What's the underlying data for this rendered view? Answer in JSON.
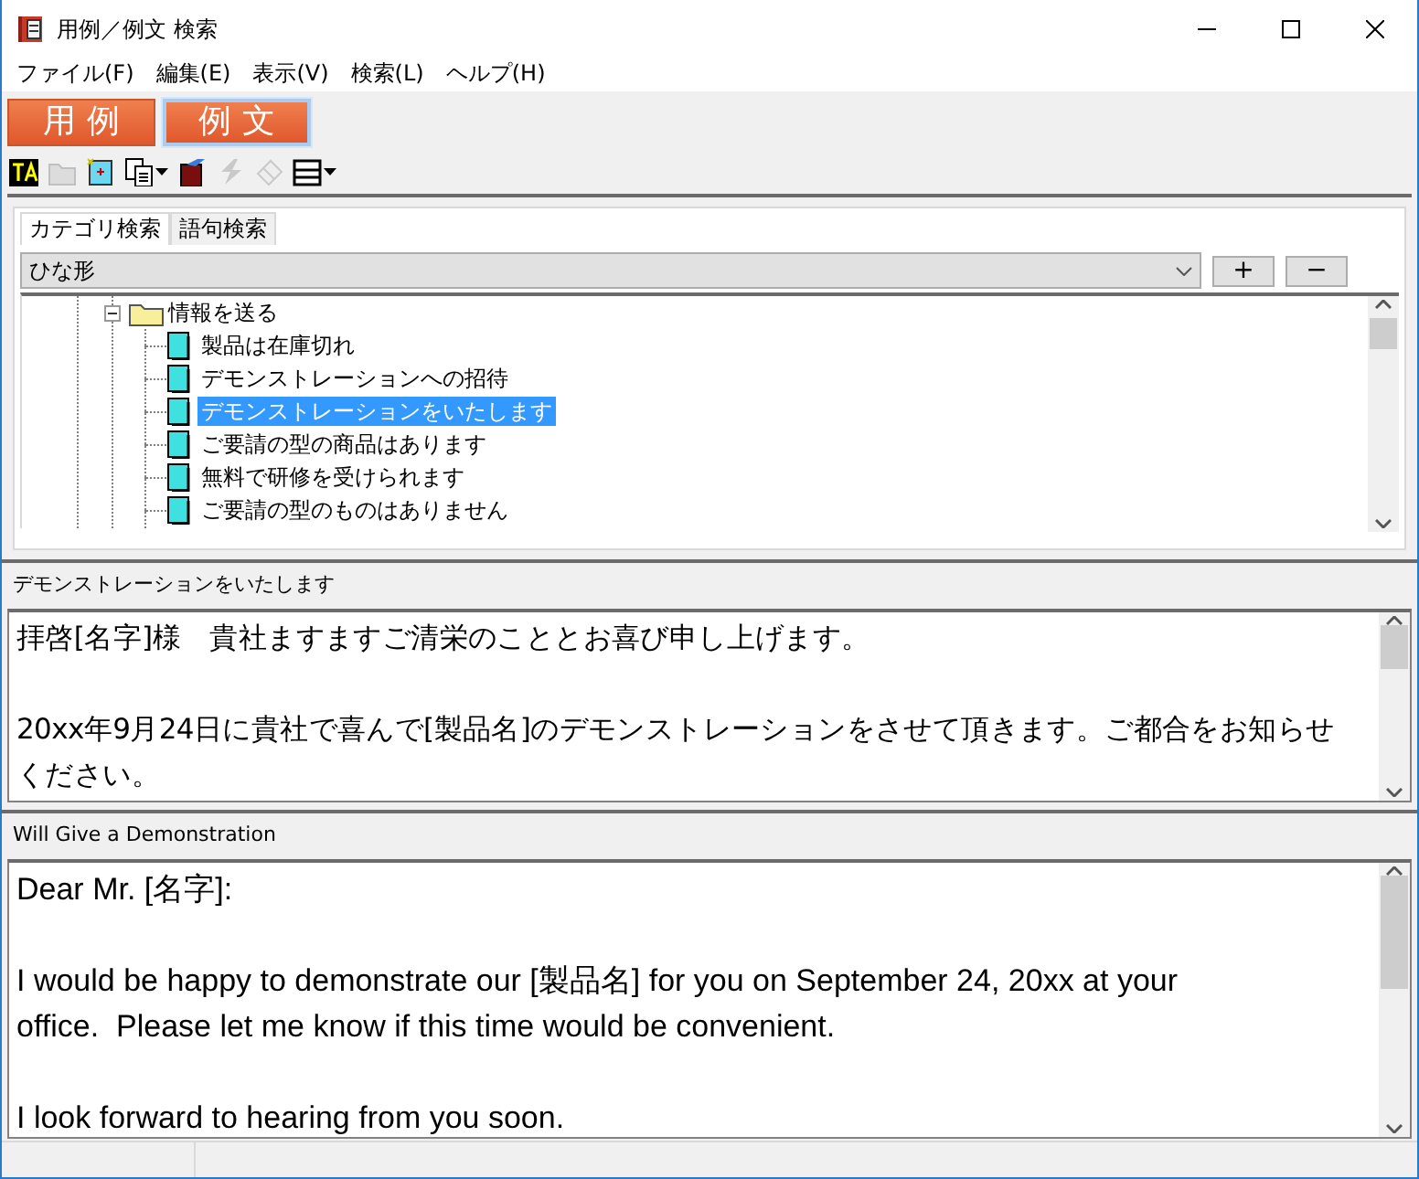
{
  "window": {
    "title": "用例／例文 検索"
  },
  "menu": [
    "ファイル(F)",
    "編集(E)",
    "表示(V)",
    "検索(L)",
    "ヘルプ(H)"
  ],
  "modes": [
    {
      "label": "用 例",
      "selected": false
    },
    {
      "label": "例 文",
      "selected": true
    }
  ],
  "toolbar": [
    {
      "kind": "text",
      "disabled": false,
      "dropdown": false
    },
    {
      "kind": "folder",
      "disabled": true,
      "dropdown": false
    },
    {
      "kind": "newdoc",
      "disabled": false,
      "dropdown": false
    },
    {
      "kind": "copy",
      "disabled": false,
      "dropdown": true
    },
    {
      "kind": "book",
      "disabled": false,
      "dropdown": false
    },
    {
      "kind": "bolt",
      "disabled": true,
      "dropdown": false
    },
    {
      "kind": "eraser",
      "disabled": true,
      "dropdown": false
    },
    {
      "kind": "layout",
      "disabled": false,
      "dropdown": true
    }
  ],
  "search_tabs": [
    {
      "label": "カテゴリ検索",
      "selected": true
    },
    {
      "label": "語句検索",
      "selected": false
    }
  ],
  "category": {
    "value": "ひな形",
    "buttons": [
      "+",
      "−"
    ]
  },
  "tree": {
    "label": "情報を送る",
    "expanded": true,
    "children": [
      {
        "label": "製品は在庫切れ",
        "selected": false
      },
      {
        "label": "デモンストレーションへの招待",
        "selected": false
      },
      {
        "label": "デモンストレーションをいたします",
        "selected": true
      },
      {
        "label": "ご要請の型の商品はあります",
        "selected": false
      },
      {
        "label": "無料で研修を受けられます",
        "selected": false
      },
      {
        "label": "ご要請の型のものはありません",
        "selected": false
      }
    ]
  },
  "japanese": {
    "title": "デモンストレーションをいたします",
    "paragraphs": [
      [
        "拝啓[名字]様　貴社ますますご清栄のこととお喜び申し上げます。"
      ],
      [
        "20xx年9月24日に貴社で喜んで[製品名]のデモンストレーションをさせて頂きます。ご都合をお知らせ",
        "ください。"
      ]
    ]
  },
  "english": {
    "title": "Will Give a Demonstration",
    "paragraphs": [
      [
        "Dear Mr. [名字]:"
      ],
      [
        "I would be happy to demonstrate our [製品名] for you on September 24, 20xx at your",
        "office.  Please let me know if this time would be convenient."
      ],
      [
        "I look forward to hearing from you soon."
      ]
    ]
  }
}
